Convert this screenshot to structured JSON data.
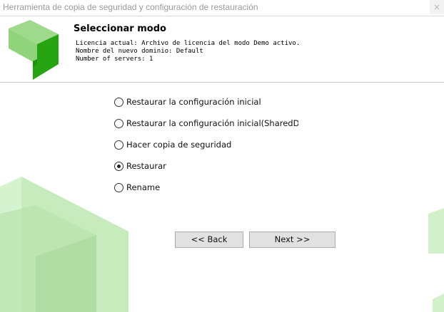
{
  "window": {
    "title": "Herramienta de copia de seguridad y configuración de restauración",
    "close_label": "×"
  },
  "header": {
    "title": "Seleccionar modo",
    "info_lines": [
      "Licencia actual: Archivo de licencia del modo Demo activo.",
      "Nombre del nuevo dominio: Default",
      "Number of servers: 1"
    ]
  },
  "options": [
    {
      "label": "Restaurar la configuración inicial",
      "selected": false
    },
    {
      "label": "Restaurar la configuración inicial(SharedDB)",
      "selected": false
    },
    {
      "label": "Hacer copia de seguridad",
      "selected": false
    },
    {
      "label": "Restaurar",
      "selected": true
    },
    {
      "label": "Rename",
      "selected": false
    }
  ],
  "buttons": {
    "back": "<< Back",
    "next": "Next >>"
  },
  "colors": {
    "logo_light": "#8fd47a",
    "logo_dark": "#27a412",
    "deco_green": "#c9efc0"
  }
}
